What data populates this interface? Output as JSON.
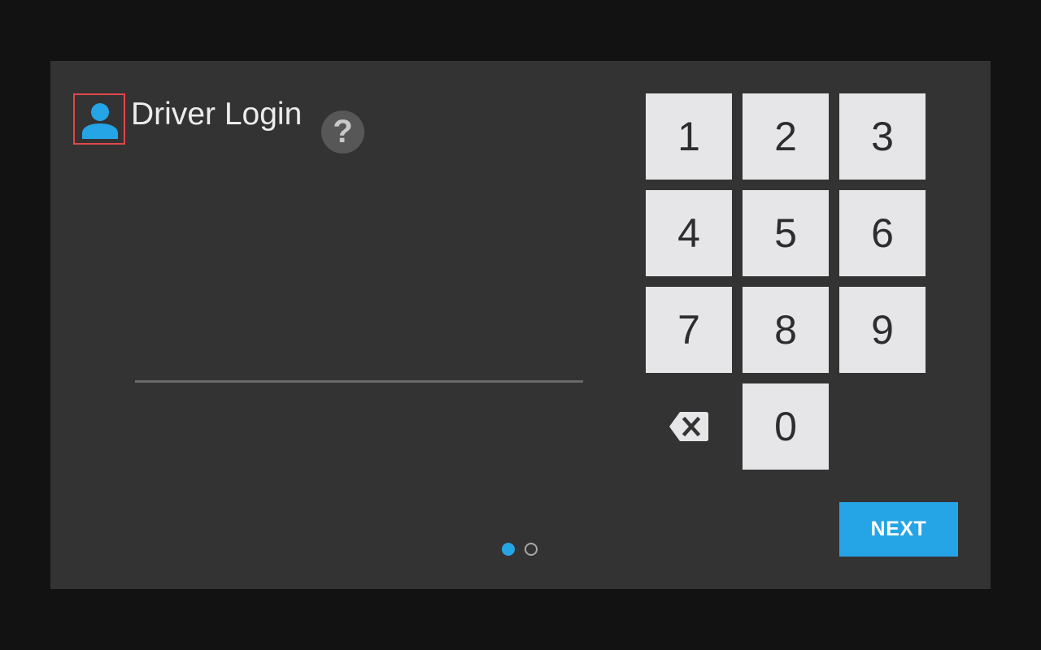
{
  "login": {
    "title": "Driver Login",
    "help_symbol": "?",
    "pin_value": ""
  },
  "keypad": {
    "keys": [
      "1",
      "2",
      "3",
      "4",
      "5",
      "6",
      "7",
      "8",
      "9",
      "0"
    ]
  },
  "actions": {
    "next_label": "NEXT"
  },
  "pager": {
    "total_pages": 2,
    "current_page": 1
  },
  "colors": {
    "accent": "#25a4e6",
    "panel": "#333333",
    "key_bg": "#e6e6e8",
    "highlight": "#e0474c"
  },
  "icons": {
    "user": "user-icon",
    "help": "help-icon",
    "backspace": "backspace-icon"
  }
}
